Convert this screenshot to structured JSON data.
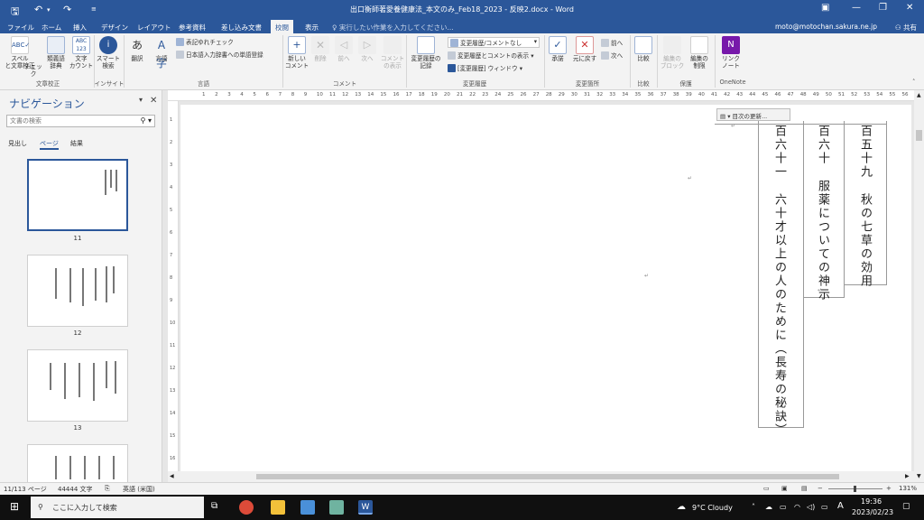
{
  "window": {
    "title": "出口衡師著愛養健康法_本文のみ_Feb18_2023 - 反映2.docx - Word",
    "account": "moto@motochan.sakura.ne.jp",
    "share": "共有",
    "tell_me": "実行したい作業を入力してください..."
  },
  "tabs": [
    "ファイル",
    "ホーム",
    "挿入",
    "デザイン",
    "レイアウト",
    "参考資料",
    "差し込み文書",
    "校閲",
    "表示"
  ],
  "active_tab": "校閲",
  "ribbon": {
    "proofing": {
      "spell": "スペル\nと文章校正",
      "check": "チェック",
      "thesaurus": "類義語\n辞典",
      "wordcount": "文字\nカウント",
      "group": "文章校正"
    },
    "insight": {
      "smart": "スマート\n検索",
      "group": "インサイト"
    },
    "language": {
      "translate": "翻訳",
      "lang": "言語",
      "check_notation": "表記ゆれチェック",
      "dictionary": "日本語入力辞書への単語登録",
      "group": "言語"
    },
    "comments": {
      "new": "新しい\nコメント",
      "delete": "削除",
      "prev": "前へ",
      "next": "次へ",
      "show": "コメント\nの表示",
      "group": "コメント"
    },
    "tracking": {
      "track": "変更履歴の\n記録",
      "markup": "変更履歴/コメントなし",
      "show_markup": "変更履歴とコメントの表示",
      "pane": "[変更履歴] ウィンドウ",
      "group": "変更履歴"
    },
    "changes": {
      "accept": "承諾",
      "reject": "元に戻す",
      "prev": "前へ",
      "next": "次へ",
      "group": "変更箇所"
    },
    "compare": {
      "compare": "比較",
      "group": "比較"
    },
    "protect": {
      "block": "編集の\nブロック",
      "restrict": "編集の\n制限",
      "group": "保護"
    },
    "onenote": {
      "link": "リンク\nノート",
      "group": "OneNote"
    }
  },
  "nav": {
    "title": "ナビゲーション",
    "search_placeholder": "文書の検索",
    "tabs": [
      "見出し",
      "ページ",
      "結果"
    ],
    "active_tab": "ページ",
    "pages": [
      "11",
      "12",
      "13"
    ]
  },
  "document": {
    "toc_button": "目次の更新...",
    "columns": [
      {
        "number": "百五十九",
        "text": "秋の七草の効用"
      },
      {
        "number": "百六十",
        "text": "服薬についての神示"
      },
      {
        "number": "百六十一",
        "text": "六十才以上の人のために（長寿の秘訣）"
      }
    ]
  },
  "status": {
    "page": "11/113 ページ",
    "words": "44444 文字",
    "language": "英語 (米国)",
    "zoom": "131%"
  },
  "taskbar": {
    "search": "ここに入力して検索",
    "weather": "9°C Cloudy",
    "time": "19:36",
    "date": "2023/02/23",
    "ime": "A"
  },
  "colors": {
    "word_blue": "#2b579a",
    "taskbar": "#101010"
  }
}
